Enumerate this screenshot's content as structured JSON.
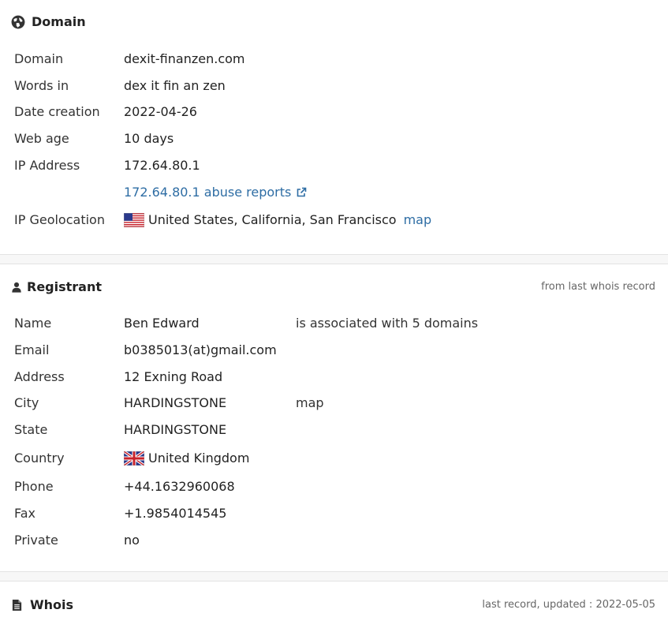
{
  "domain_section": {
    "title": "Domain",
    "icon": "globe-icon",
    "rows": {
      "domain": {
        "label": "Domain",
        "value": "dexit-finanzen.com"
      },
      "words": {
        "label": "Words in",
        "value": "dex it fin an zen"
      },
      "date_creation": {
        "label": "Date creation",
        "value": "2022-04-26"
      },
      "web_age": {
        "label": "Web age",
        "value": "10 days"
      },
      "ip": {
        "label": "IP Address",
        "value": "172.64.80.1"
      },
      "abuse": {
        "value": "172.64.80.1 abuse reports"
      },
      "geo": {
        "label": "IP Geolocation",
        "value": "United States, California, San Francisco",
        "map": "map"
      }
    }
  },
  "registrant_section": {
    "title": "Registrant",
    "icon": "user-icon",
    "note": "from last whois record",
    "rows": {
      "name": {
        "label": "Name",
        "value": "Ben Edward",
        "extra": "is associated with 5 domains"
      },
      "email": {
        "label": "Email",
        "value": "b0385013(at)gmail.com"
      },
      "address": {
        "label": "Address",
        "value": "12 Exning Road"
      },
      "city": {
        "label": "City",
        "value": "HARDINGSTONE",
        "map": "map"
      },
      "state": {
        "label": "State",
        "value": "HARDINGSTONE"
      },
      "country": {
        "label": "Country",
        "value": "United Kingdom"
      },
      "phone": {
        "label": "Phone",
        "value": "+44.1632960068"
      },
      "fax": {
        "label": "Fax",
        "value": "+1.9854014545"
      },
      "private": {
        "label": "Private",
        "value": "no"
      }
    }
  },
  "whois_section": {
    "title": "Whois",
    "icon": "file-icon",
    "note": "last record, updated : 2022-05-05"
  },
  "colors": {
    "link": "#2e6da4",
    "text": "#222222",
    "muted": "#666666",
    "divider_bg": "#f7f7f7"
  }
}
